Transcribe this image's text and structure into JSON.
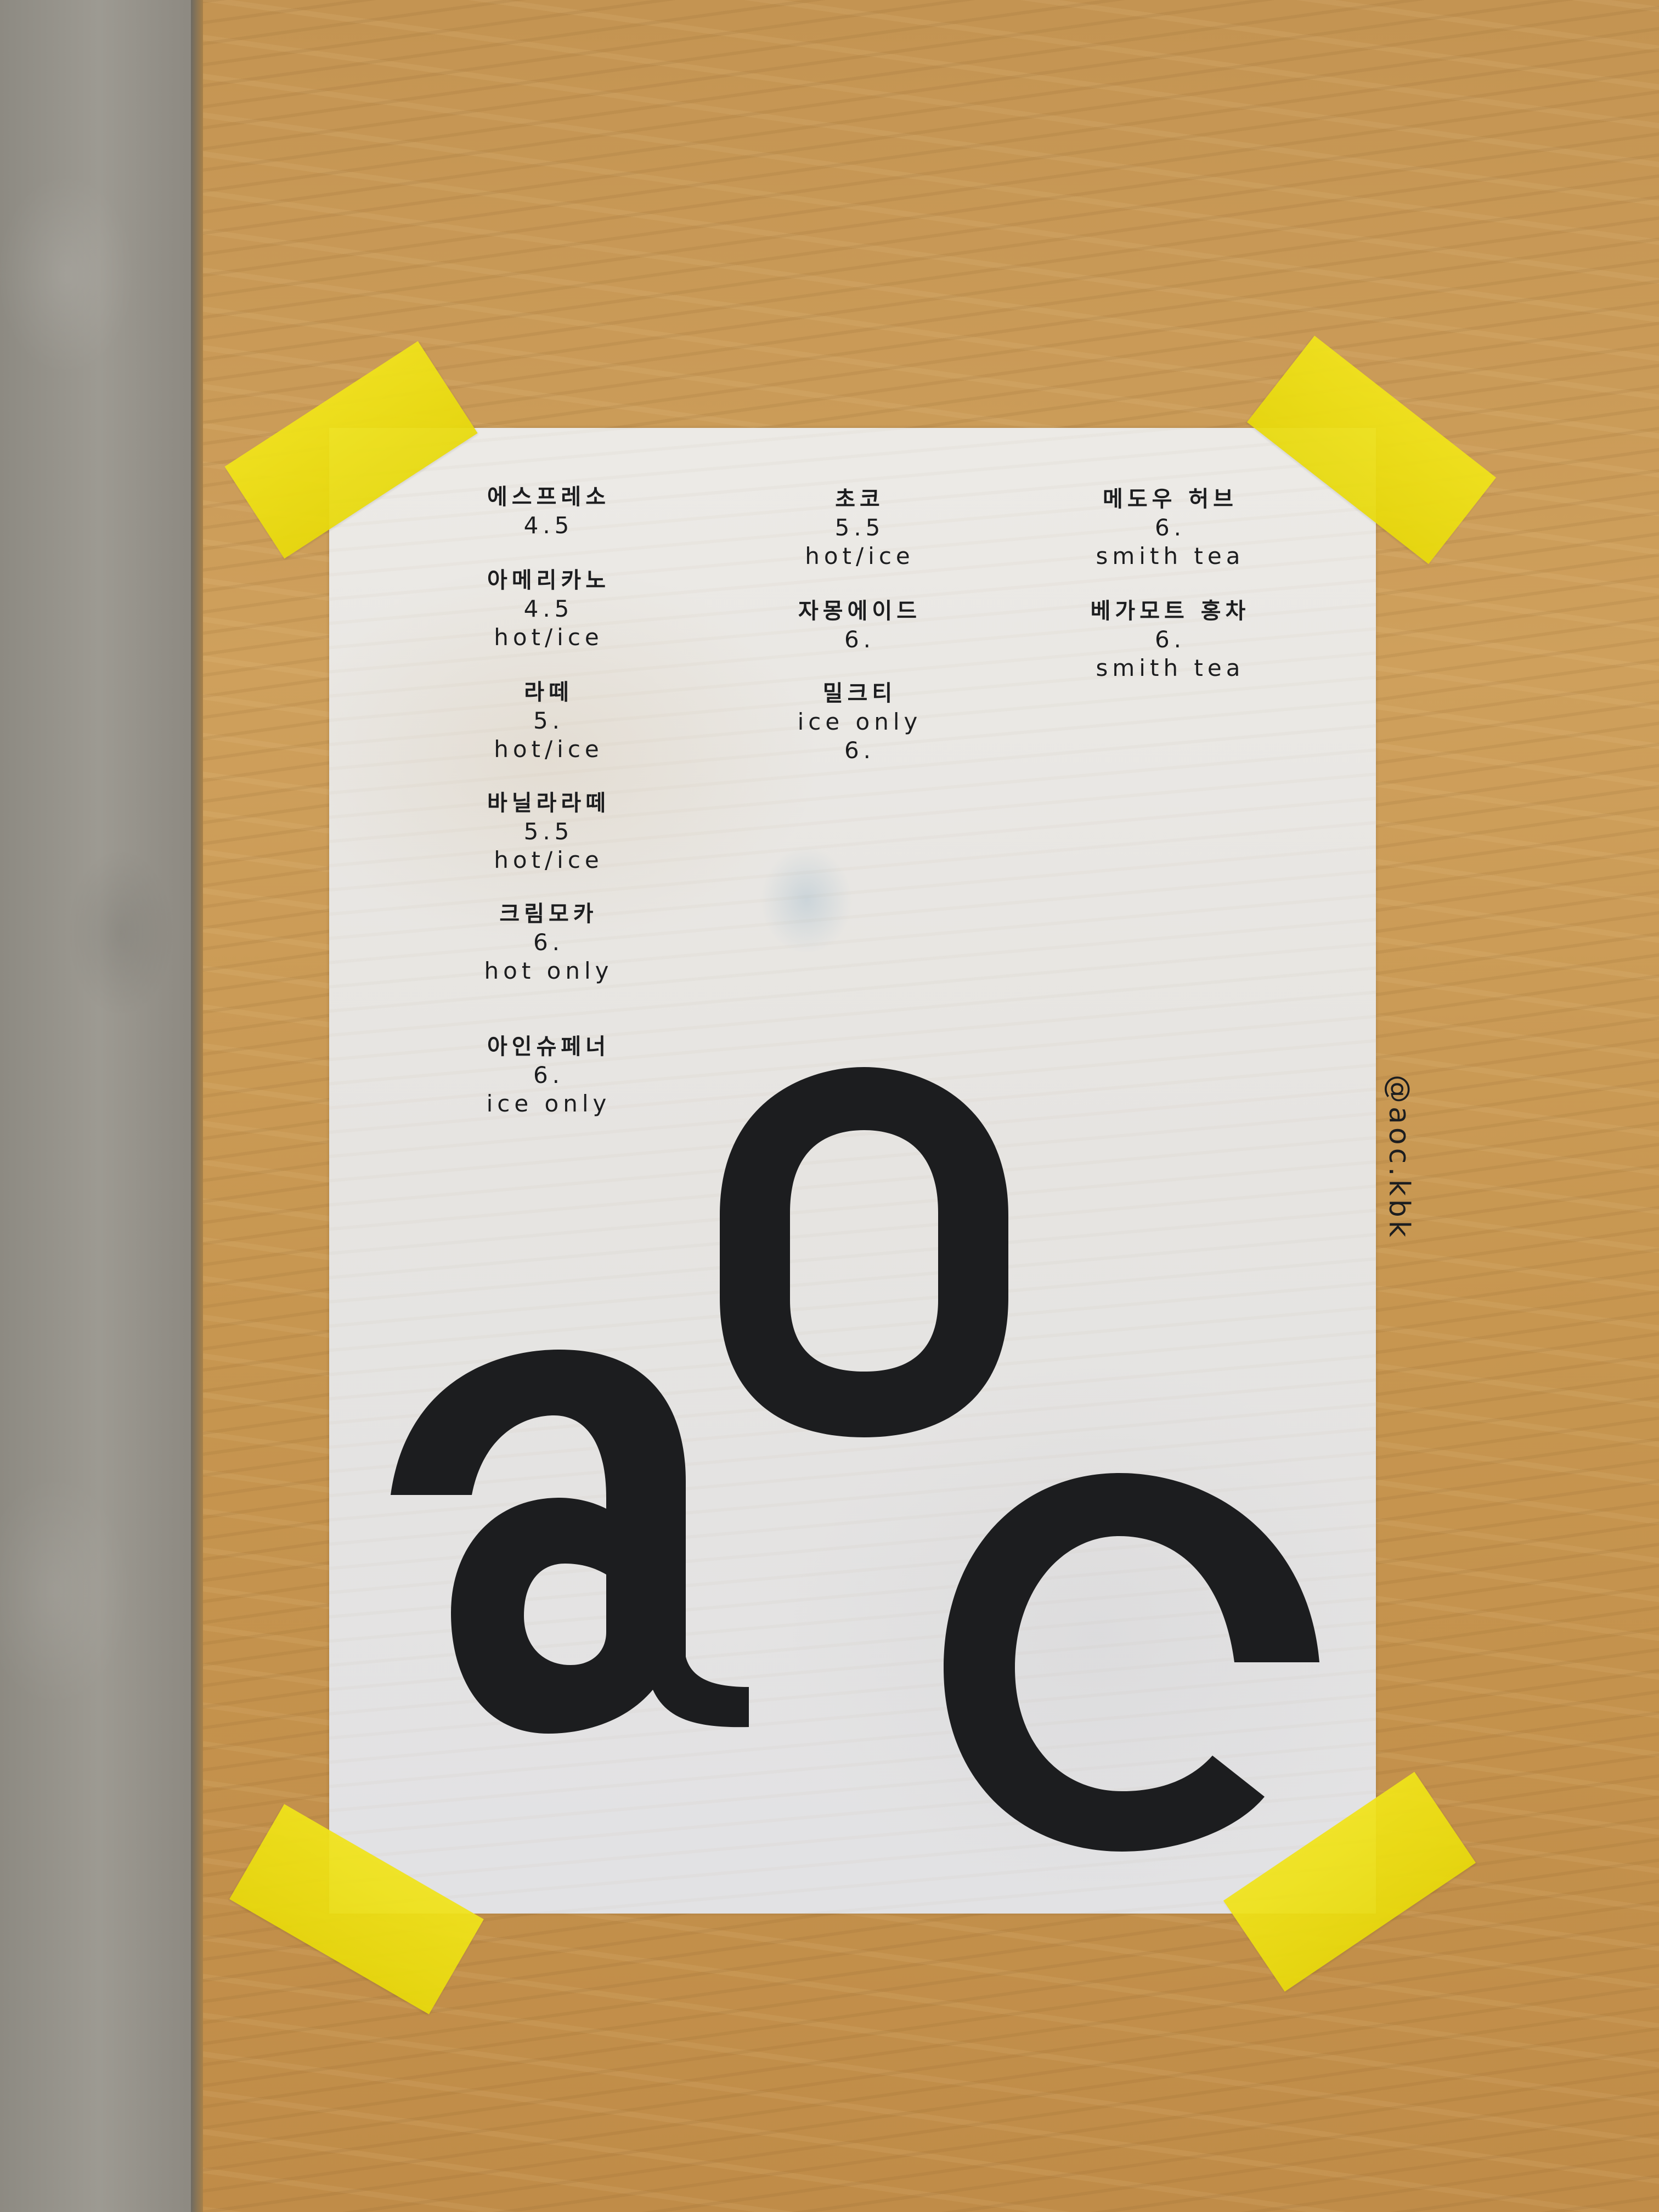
{
  "menu": {
    "column1": [
      {
        "name": "에스프레소",
        "price": "4.5",
        "note": ""
      },
      {
        "name": "아메리카노",
        "price": "4.5",
        "note": "hot/ice"
      },
      {
        "name": "라떼",
        "price": "5.",
        "note": "hot/ice"
      },
      {
        "name": "바닐라라떼",
        "price": "5.5",
        "note": "hot/ice"
      },
      {
        "name": "크림모카",
        "price": "6.",
        "note": "hot only"
      },
      {
        "name": "아인슈페너",
        "price": "6.",
        "note": "ice only"
      }
    ],
    "column2": [
      {
        "name": "초코",
        "price": "5.5",
        "note": "hot/ice"
      },
      {
        "name": "자몽에이드",
        "price": "6.",
        "note": ""
      },
      {
        "name": "밀크티",
        "line2": "ice only",
        "line3": "6."
      }
    ],
    "column3": [
      {
        "name": "메도우 허브",
        "price": "6.",
        "note": "smith tea"
      },
      {
        "name": "베가모트 홍차",
        "price": "6.",
        "note": "smith tea"
      }
    ]
  },
  "instagram_handle": "@aoc.kbk",
  "logo_letters": [
    "a",
    "o",
    "c"
  ],
  "colors": {
    "tape": "#f1e41a",
    "paper": "#e8e6e3",
    "ink": "#1c1d1f",
    "table": "#c79650",
    "floor": "#96938b"
  }
}
